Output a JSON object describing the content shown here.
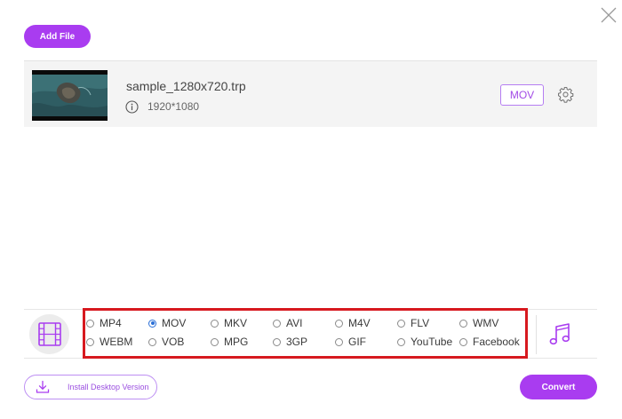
{
  "toolbar": {
    "add_file_label": "Add File"
  },
  "file": {
    "name": "sample_1280x720.trp",
    "resolution": "1920*1080",
    "output_format": "MOV"
  },
  "formats": [
    {
      "label": "MP4",
      "selected": false
    },
    {
      "label": "MOV",
      "selected": true
    },
    {
      "label": "MKV",
      "selected": false
    },
    {
      "label": "AVI",
      "selected": false
    },
    {
      "label": "M4V",
      "selected": false
    },
    {
      "label": "FLV",
      "selected": false
    },
    {
      "label": "WMV",
      "selected": false
    },
    {
      "label": "WEBM",
      "selected": false
    },
    {
      "label": "VOB",
      "selected": false
    },
    {
      "label": "MPG",
      "selected": false
    },
    {
      "label": "3GP",
      "selected": false
    },
    {
      "label": "GIF",
      "selected": false
    },
    {
      "label": "YouTube",
      "selected": false
    },
    {
      "label": "Facebook",
      "selected": false
    }
  ],
  "footer": {
    "install_label": "Install Desktop Version",
    "convert_label": "Convert"
  },
  "icons": {
    "close": "close-icon",
    "info": "info-icon",
    "settings": "gear-icon",
    "video_tab": "film-icon",
    "audio_tab": "music-note-icon",
    "install": "download-icon"
  },
  "colors": {
    "accent": "#a93cf0",
    "highlight": "#d7191f",
    "radio_checked": "#2b6fd6"
  }
}
